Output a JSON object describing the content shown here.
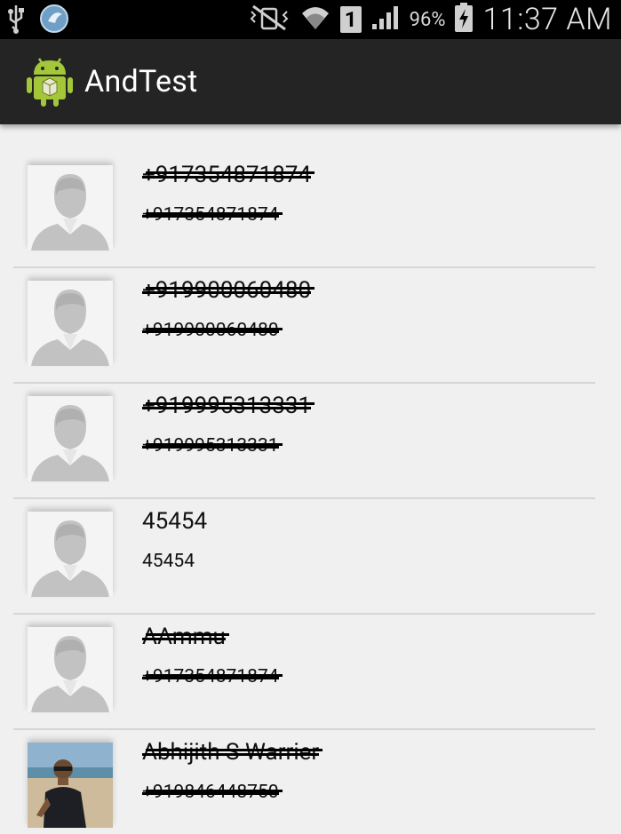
{
  "status_bar": {
    "battery": "96%",
    "time": "11:37 AM",
    "sim_slot": "1",
    "icons": [
      "usb-icon",
      "browser-icon",
      "mute-vibrate-icon",
      "wifi-icon",
      "sim-icon",
      "signal-icon",
      "battery-charging-icon"
    ]
  },
  "action_bar": {
    "title": "AndTest",
    "icon": "android-app-icon"
  },
  "contacts": [
    {
      "name": "+917354871874",
      "phone": "+917354871874",
      "avatar": "default-avatar-icon",
      "redacted": true
    },
    {
      "name": "+919900060480",
      "phone": "+919900060480",
      "avatar": "default-avatar-icon",
      "redacted": true
    },
    {
      "name": "+919995313331",
      "phone": "+919995313331",
      "avatar": "default-avatar-icon",
      "redacted": true
    },
    {
      "name": "45454",
      "phone": "45454",
      "avatar": "default-avatar-icon",
      "redacted": false
    },
    {
      "name": "AAmmu",
      "phone": "+917354871874",
      "avatar": "default-avatar-icon",
      "redacted": true
    },
    {
      "name": "Abhijith S Warrier",
      "phone": "+919846448750",
      "avatar": "photo-avatar",
      "redacted": true
    }
  ]
}
